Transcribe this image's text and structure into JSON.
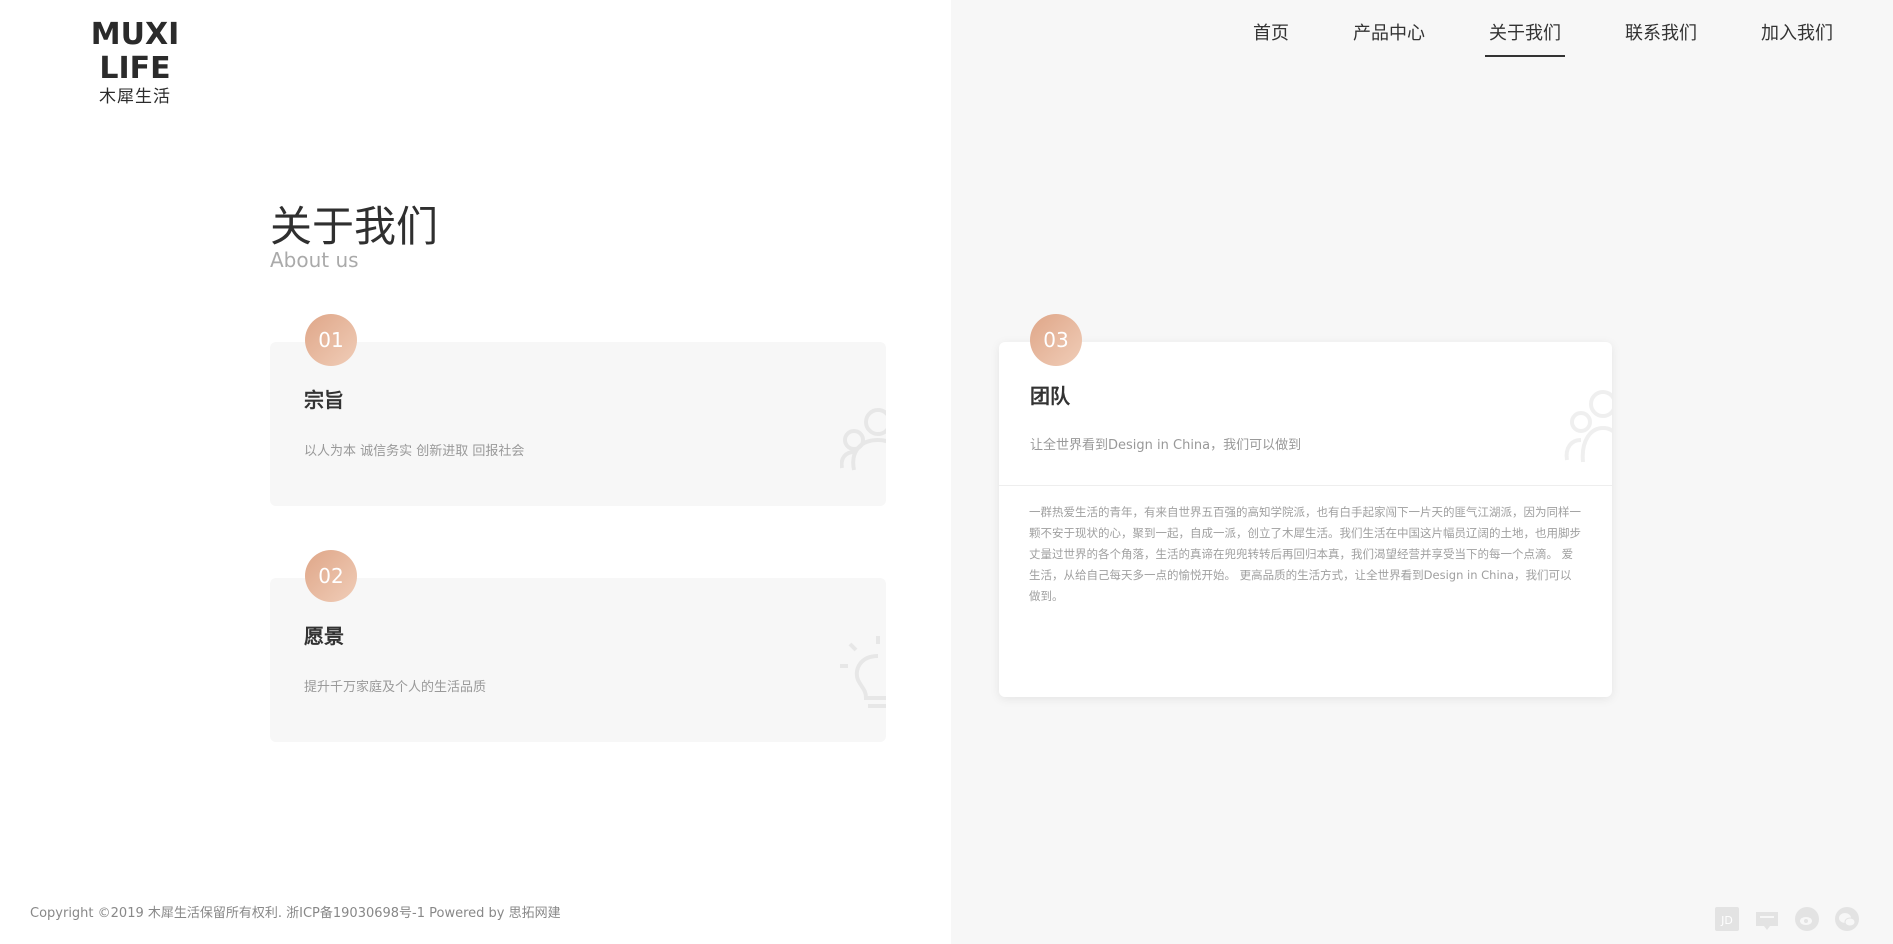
{
  "logo": {
    "en": "MUXI LIFE",
    "cn": "木犀生活"
  },
  "nav": [
    {
      "label": "首页",
      "active": false
    },
    {
      "label": "产品中心",
      "active": false
    },
    {
      "label": "关于我们",
      "active": true
    },
    {
      "label": "联系我们",
      "active": false
    },
    {
      "label": "加入我们",
      "active": false
    }
  ],
  "section": {
    "title": "关于我们",
    "subtitle": "About us"
  },
  "cards": [
    {
      "num": "01",
      "title": "宗旨",
      "text": "以人为本 诚信务实 创新进取 回报社会",
      "icon": "community-icon"
    },
    {
      "num": "02",
      "title": "愿景",
      "text": "提升千万家庭及个人的生活品质",
      "icon": "lightbulb-icon"
    },
    {
      "num": "03",
      "title": "团队",
      "text": "让全世界看到Design in China，我们可以做到",
      "desc": "一群热爱生活的青年，有来自世界五百强的高知学院派，也有白手起家闯下一片天的匪气江湖派，因为同样一颗不安于现状的心，聚到一起，自成一派，创立了木犀生活。我们生活在中国这片幅员辽阔的土地，也用脚步丈量过世界的各个角落，生活的真谛在兜兜转转后再回归本真，我们渴望经营并享受当下的每一个点滴。 爱生活，从给自己每天多一点的愉悦开始。 更高品质的生活方式，让全世界看到Design in China，我们可以做到。",
      "icon": "team-icon"
    }
  ],
  "footer": {
    "text": "Copyright ©2019 木犀生活保留所有权利. 浙ICP备19030698号-1 Powered by 思拓网建"
  },
  "social": [
    {
      "icon": "jd-icon",
      "label": "JD"
    },
    {
      "icon": "tmall-icon"
    },
    {
      "icon": "weibo-icon"
    },
    {
      "icon": "wechat-icon"
    }
  ],
  "colors": {
    "accent_start": "#dfa688",
    "accent_end": "#f0cdb8",
    "right_panel": "#f7f7f7"
  }
}
